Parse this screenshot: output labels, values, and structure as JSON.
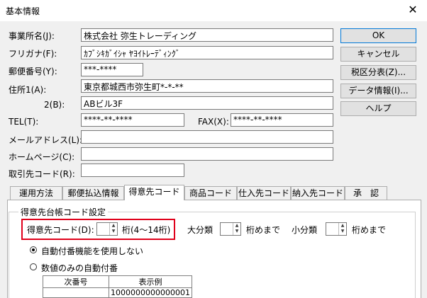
{
  "window": {
    "title": "基本情報",
    "close_glyph": "✕"
  },
  "form": {
    "company_name": {
      "label": "事業所名(J):",
      "value": "株式会社 弥生トレーディング"
    },
    "furigana": {
      "label": "フリガナ(F):",
      "value": "ｶﾌﾞｼｷｶﾞｲｼｬ ﾔﾖｲﾄﾚｰﾃﾞｨﾝｸﾞ"
    },
    "postal_code": {
      "label": "郵便番号(Y):",
      "value": "***-****"
    },
    "address1": {
      "label": "住所1(A):",
      "value": "東京都城西市弥生町*-*-**"
    },
    "address2": {
      "label": "2(B):",
      "value": "ABビル3F"
    },
    "tel": {
      "label": "TEL(T):",
      "value": "****-**-****"
    },
    "fax": {
      "label": "FAX(X):",
      "value": "****-**-****"
    },
    "email": {
      "label": "メールアドレス(L):",
      "value": ""
    },
    "homepage": {
      "label": "ホームページ(C):",
      "value": ""
    },
    "partner_code": {
      "label": "取引先コード(R):",
      "value": ""
    }
  },
  "buttons": {
    "ok": "OK",
    "cancel": "キャンセル",
    "tax_table": "税区分表(Z)...",
    "data_info": "データ情報(I)...",
    "help": "ヘルプ"
  },
  "tabs": [
    "運用方法",
    "郵便払込情報",
    "得意先コード",
    "商品コード",
    "仕入先コード",
    "納入先コード",
    "承　認"
  ],
  "active_tab": "得意先コード",
  "group": {
    "title": "得意先台帳コード設定",
    "customer_code_label": "得意先コード(D):",
    "customer_code_value": "",
    "digits_hint": "桁(4〜14桁)",
    "major_class_label": "大分類",
    "major_class_value": "",
    "major_suffix": "桁めまで",
    "minor_class_label": "小分類",
    "minor_class_value": "",
    "minor_suffix": "桁めまで",
    "radio_none": "自動付番機能を使用しない",
    "radio_numeric": "数値のみの自動付番",
    "table": {
      "headers": [
        "次番号",
        "表示例"
      ],
      "row": [
        "",
        "1000000000000001"
      ]
    }
  },
  "colors": {
    "highlight": "#e0001b",
    "default_button_border": "#0078d7"
  }
}
